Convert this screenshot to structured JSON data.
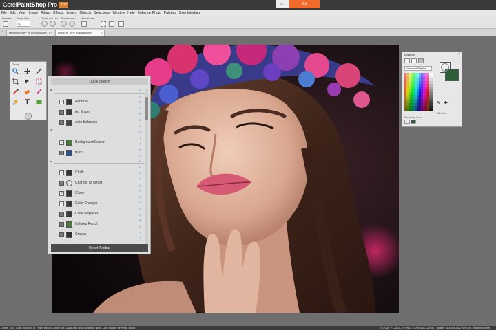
{
  "app": {
    "brand_prefix": "Corel",
    "brand_name": "PaintShop",
    "brand_suffix": " Pro",
    "version": "2020"
  },
  "workspace_tabs": {
    "home_icon": "home-icon",
    "edit_label": "Edit"
  },
  "menu": [
    "File",
    "Edit",
    "View",
    "Image",
    "Adjust",
    "Effects",
    "Layers",
    "Objects",
    "Selections",
    "Window",
    "Help",
    "Enhance Photo",
    "Palettes",
    "User Interface"
  ],
  "tool_options": {
    "labels": [
      "Presets:",
      "Zoom (%):",
      "Zoom out / in:",
      "Zoom more:",
      "Actual size:"
    ],
    "zoom_value": "50"
  },
  "documents": [
    {
      "title": "Miriamy Rolls* @ 50% (Backgr.. )",
      "active": false
    },
    {
      "title": "Brush @ 50% (Background)",
      "active": true
    }
  ],
  "tools_palette": {
    "title": "Tools"
  },
  "quick_search": {
    "title": "Quick Search",
    "sections": [
      {
        "letter": "A",
        "items": [
          {
            "label": "Airbrush",
            "checked": true
          },
          {
            "label": "Art Eraser",
            "checked": false
          },
          {
            "label": "Auto Selection",
            "checked": false
          }
        ]
      },
      {
        "letter": "B",
        "items": [
          {
            "label": "Background Eraser",
            "checked": true
          },
          {
            "label": "Burn",
            "checked": false
          }
        ]
      },
      {
        "letter": "C",
        "items": [
          {
            "label": "Chalk",
            "checked": true
          },
          {
            "label": "Change To Target",
            "checked": false
          },
          {
            "label": "Clone",
            "checked": true
          },
          {
            "label": "Color Changer",
            "checked": true
          },
          {
            "label": "Color Replacer",
            "checked": false
          },
          {
            "label": "Colored Pencil",
            "checked": false
          },
          {
            "label": "Crayon",
            "checked": false
          }
        ]
      }
    ],
    "alphabet": [
      "A",
      "B",
      "C",
      "D",
      "E",
      "F",
      "G",
      "H",
      "I",
      "J",
      "K",
      "L",
      "M",
      "N",
      "O",
      "P",
      "Q",
      "R",
      "S",
      "T",
      "U",
      "V",
      "W",
      "X",
      "Y",
      "Z"
    ],
    "reset_label": "Reset Toolbar"
  },
  "materials": {
    "title": "Materials",
    "palette_select": "Standard Palette",
    "all_tools_label": "All tools",
    "recent_label": "Recently Used",
    "foreground": "#f2f2f2",
    "background": "#2e5c3a"
  },
  "status": {
    "left": "Zoom Tool: Click to zoom in. Right click to zoom out. Click and drag to define area. Use mouse wheel to zoom.",
    "right": "(x:2734 y:1321) - (R:99,G:157,B:154,O:255) - Image : 4000 x 2667 x RGB - 8 bits/channel"
  }
}
